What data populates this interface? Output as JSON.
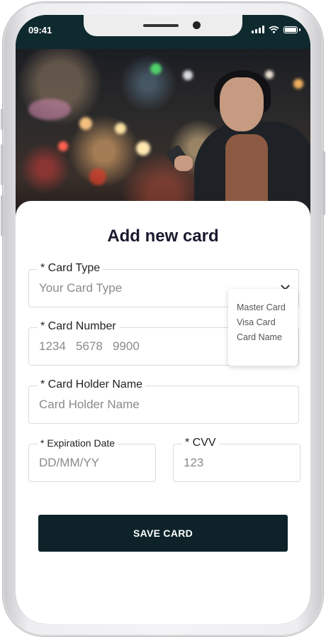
{
  "status_bar": {
    "time": "09:41"
  },
  "form": {
    "title": "Add new card",
    "card_type": {
      "label": "* Card Type",
      "value": "Your Card Type"
    },
    "card_type_options": [
      "Master Card",
      "Visa Card",
      "Card Name"
    ],
    "card_number": {
      "label": "* Card Number",
      "value": "1234   5678   9900"
    },
    "holder_name": {
      "label": "* Card Holder Name",
      "value": "Card Holder Name"
    },
    "expiration": {
      "label": "* Expiration Date",
      "value": "DD/MM/YY"
    },
    "cvv": {
      "label": "* CVV",
      "value": "123"
    },
    "save_label": "SAVE CARD"
  },
  "colors": {
    "primary": "#0d2329",
    "status_bar": "#0f2a2f"
  }
}
